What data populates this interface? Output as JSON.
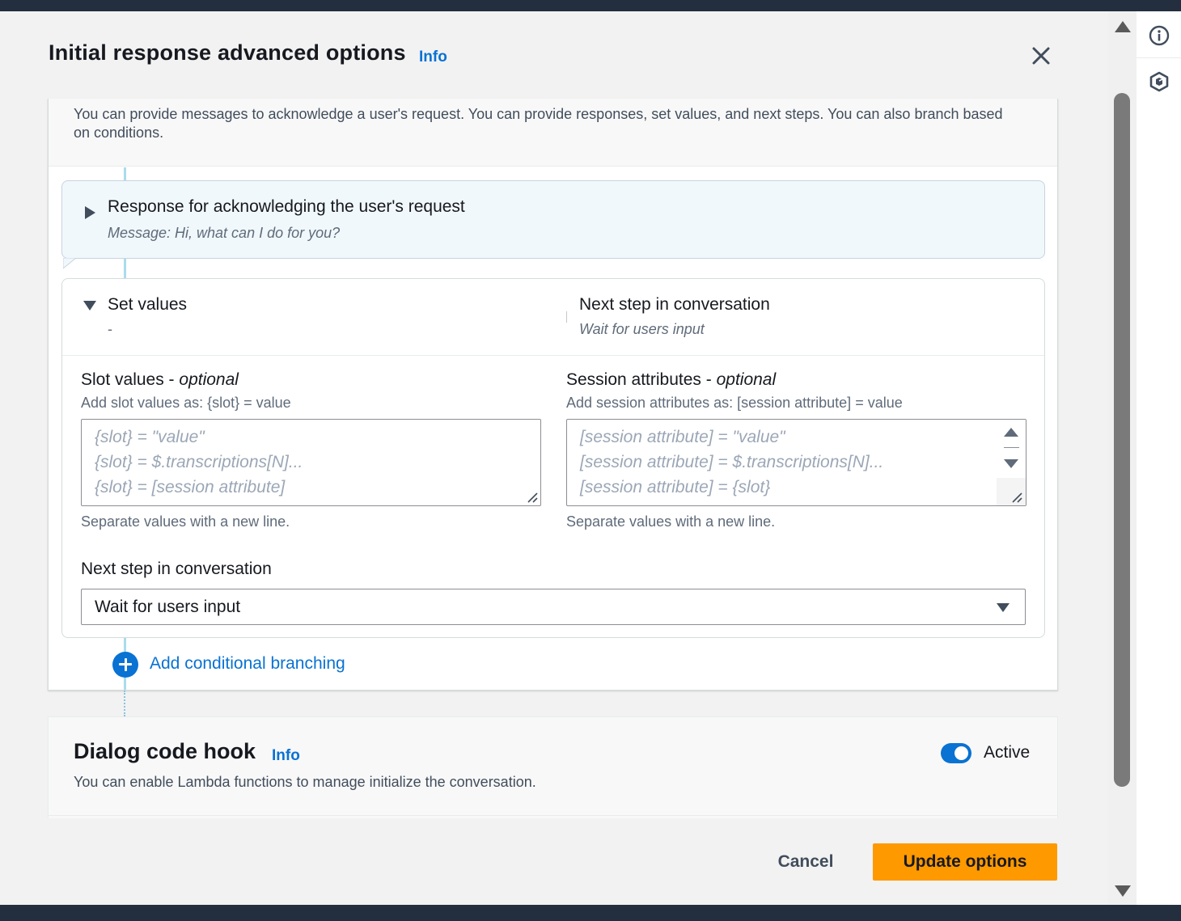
{
  "modal": {
    "title": "Initial response advanced options",
    "info_label": "Info",
    "description": "You can provide messages to acknowledge a user's request. You can provide responses, set values, and next steps. You can also branch based on conditions."
  },
  "acknowledge": {
    "title": "Response for acknowledging the user's request",
    "message": "Message: Hi, what can I do for you?"
  },
  "set_values": {
    "title": "Set values",
    "summary": "-",
    "next_step_title": "Next step in conversation",
    "next_step_summary": "Wait for users input",
    "slot_values": {
      "label": "Slot values - ",
      "optional": "optional",
      "hint": "Add slot values as: {slot} = value",
      "placeholder_lines": [
        "{slot} = \"value\"",
        "{slot} = $.transcriptions[N]...",
        "{slot} = [session attribute]"
      ],
      "footer": "Separate values with a new line."
    },
    "session_attributes": {
      "label": "Session attributes - ",
      "optional": "optional",
      "hint": "Add session attributes as: [session attribute] = value",
      "placeholder_lines": [
        "[session attribute] = \"value\"",
        "[session attribute] = $.transcriptions[N]...",
        "[session attribute] = {slot}"
      ],
      "footer": "Separate values with a new line."
    },
    "next_step_field": {
      "label": "Next step in conversation",
      "selected": "Wait for users input"
    }
  },
  "add_branching_label": "Add conditional branching",
  "dialog_code_hook": {
    "title": "Dialog code hook",
    "info_label": "Info",
    "description": "You can enable Lambda functions to manage initialize the conversation.",
    "toggle_label": "Active",
    "toggle_on": true
  },
  "footer": {
    "cancel_label": "Cancel",
    "update_label": "Update options"
  },
  "colors": {
    "primary_blue": "#0972d3",
    "accent_orange": "#ff9900",
    "header_dark": "#232f3e"
  },
  "icons": [
    "close-icon",
    "caret-right-icon",
    "caret-down-icon",
    "plus-circle-icon",
    "info-circle-icon",
    "hexagon-icon",
    "resize-grip-icon"
  ]
}
